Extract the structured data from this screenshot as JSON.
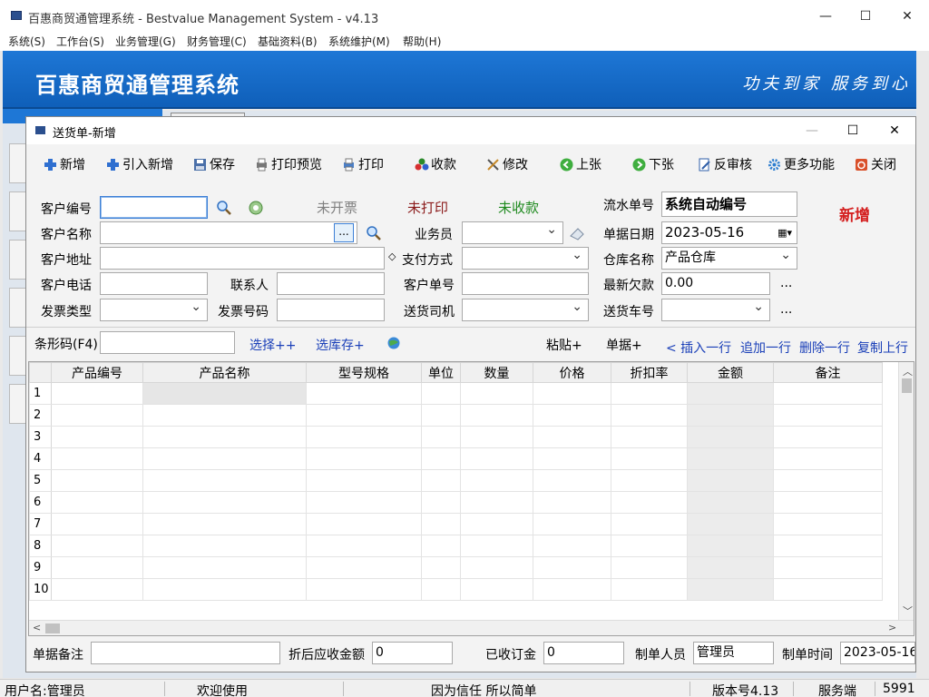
{
  "window": {
    "title": "百惠商贸通管理系统 - Bestvalue Management System - v4.13",
    "minimize": "—",
    "maximize": "☐",
    "close": "✕"
  },
  "menu": [
    "系统(S)",
    "工作台(S)",
    "业务管理(G)",
    "财务管理(C)",
    "基础资料(B)",
    "系统维护(M)",
    "帮助(H)"
  ],
  "banner": {
    "name": "百惠商贸通管理系统",
    "slogan": "功夫到家 服务到心"
  },
  "dialog": {
    "title": "送货单-新增",
    "minimize": "—",
    "maximize": "☐",
    "close": "✕"
  },
  "toolbar": {
    "new": "新增",
    "import_new": "引入新增",
    "save": "保存",
    "print_preview": "打印预览",
    "print": "打印",
    "collect": "收款",
    "modify": "修改",
    "post": "上张",
    "next": "下张",
    "unaudit": "反审核",
    "more": "更多功能",
    "close": "关闭"
  },
  "form": {
    "customer_code_label": "客户编号",
    "customer_code": "",
    "invoice_status": "未开票",
    "print_status": "未打印",
    "payment_status": "未收款",
    "serial_no_label": "流水单号",
    "serial_no": "系统自动编号",
    "mode_badge": "新增",
    "customer_name_label": "客户名称",
    "customer_name": "",
    "ellipsis": "...",
    "salesman_label": "业务员",
    "salesman": "",
    "doc_date_label": "单据日期",
    "doc_date": "2023-05-16",
    "customer_address_label": "客户地址",
    "customer_address": "",
    "payment_method_label": "支付方式",
    "payment_method": "",
    "warehouse_label": "仓库名称",
    "warehouse": "产品仓库",
    "customer_phone_label": "客户电话",
    "customer_phone": "",
    "contact_label": "联系人",
    "contact": "",
    "customer_doc_no_label": "客户单号",
    "customer_doc_no": "",
    "latest_debt_label": "最新欠款",
    "latest_debt": "0.00",
    "invoice_type_label": "发票类型",
    "invoice_type": "",
    "invoice_no_label": "发票号码",
    "invoice_no": "",
    "driver_label": "送货司机",
    "driver": "",
    "vehicle_label": "送货车号",
    "vehicle": "",
    "more_dots": "..."
  },
  "barcode": {
    "label": "条形码(F4)",
    "value": "",
    "select_plus": "选择++",
    "select_stock": "选库存+",
    "paste": "粘贴+",
    "doc": "单据+",
    "insert_row": "< 插入一行",
    "append_row": "追加一行",
    "delete_row": "删除一行",
    "copy_row": "复制上行"
  },
  "grid": {
    "columns": [
      "",
      "产品编号",
      "产品名称",
      "型号规格",
      "单位",
      "数量",
      "价格",
      "折扣率",
      "金额",
      "备注"
    ],
    "rows": [
      "1",
      "2",
      "3",
      "4",
      "5",
      "6",
      "7",
      "8",
      "9",
      "10"
    ]
  },
  "footer": {
    "remark_label": "单据备注",
    "remark": "",
    "discounted_label": "折后应收金额",
    "discounted": "0",
    "deposit_label": "已收订金",
    "deposit": "0",
    "maker_label": "制单人员",
    "maker": "管理员",
    "make_time_label": "制单时间",
    "make_time": "2023-05-16"
  },
  "statusbar": {
    "user": "用户名:管理员",
    "welcome": "欢迎使用",
    "motto": "因为信任 所以简单",
    "version": "版本号4.13",
    "side": "服务端",
    "port": "5991"
  },
  "colors": {
    "banner": "#1e77d6",
    "new_badge": "#d42020",
    "uninvoiced": "#808080",
    "unprinted": "#8b1a1a",
    "unpaid": "#1f8a1f",
    "link": "#1a3fb8"
  }
}
